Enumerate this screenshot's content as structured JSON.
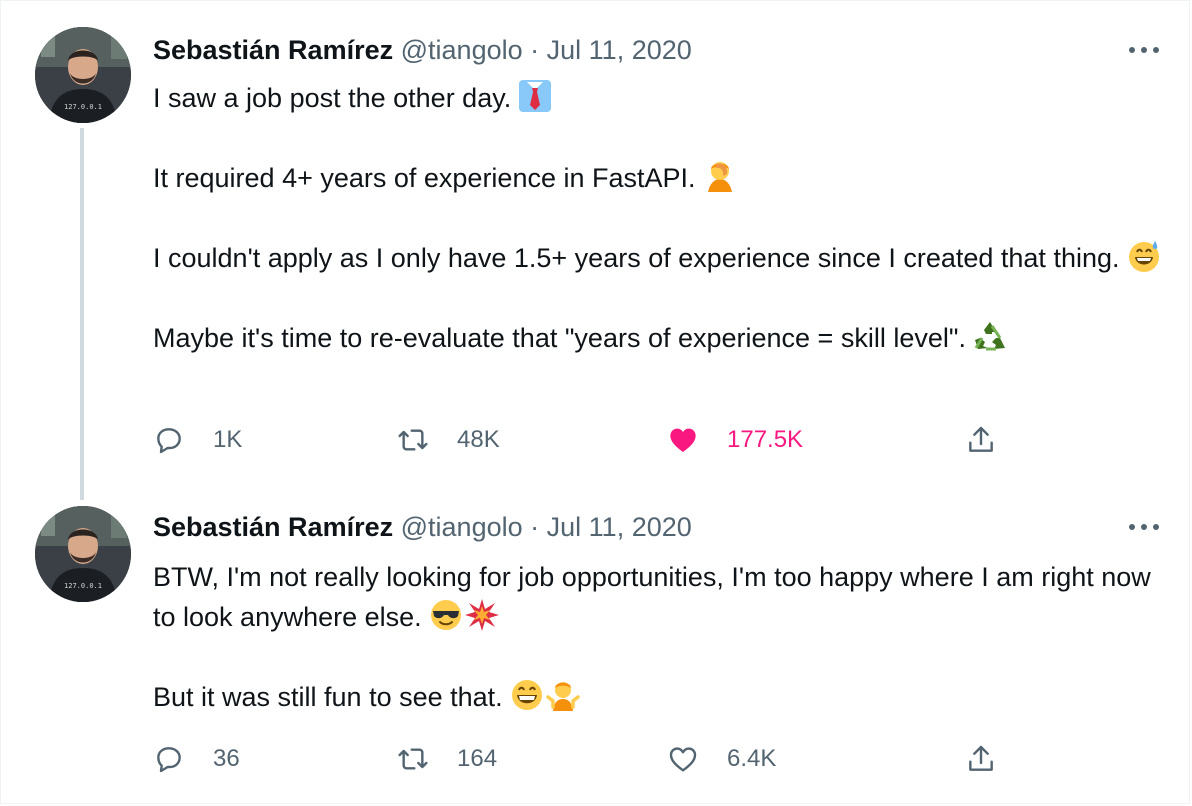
{
  "tweets": [
    {
      "author_name": "Sebastián Ramírez",
      "handle": "@tiangolo",
      "separator": "·",
      "date": "Jul 11, 2020",
      "paragraphs": [
        {
          "text": "I saw a job post the other day.",
          "emoji": "necktie"
        },
        {
          "text": "It required 4+ years of experience in FastAPI.",
          "emoji": "facepalm"
        },
        {
          "text": "I couldn't apply as I only have 1.5+ years of experience since I created that thing.",
          "emoji": "grinning-sweat"
        },
        {
          "text": "Maybe it's time to re-evaluate that \"years of experience = skill level\".",
          "emoji": "recycle"
        }
      ],
      "reply_count": "1K",
      "retweet_count": "48K",
      "like_count": "177.5K",
      "liked": true
    },
    {
      "author_name": "Sebastián Ramírez",
      "handle": "@tiangolo",
      "separator": "·",
      "date": "Jul 11, 2020",
      "paragraphs": [
        {
          "text": "BTW, I'm not really looking for job opportunities, I'm too happy where I am right now to look anywhere else.",
          "emoji": "sunglasses-collision"
        },
        {
          "text": "But it was still fun to see that.",
          "emoji": "grin-shrug"
        }
      ],
      "reply_count": "36",
      "retweet_count": "164",
      "like_count": "6.4K",
      "liked": false
    }
  ],
  "colors": {
    "text": "#0f1419",
    "secondary": "#536471",
    "like": "#f91880",
    "thread_line": "#cfd9de"
  }
}
